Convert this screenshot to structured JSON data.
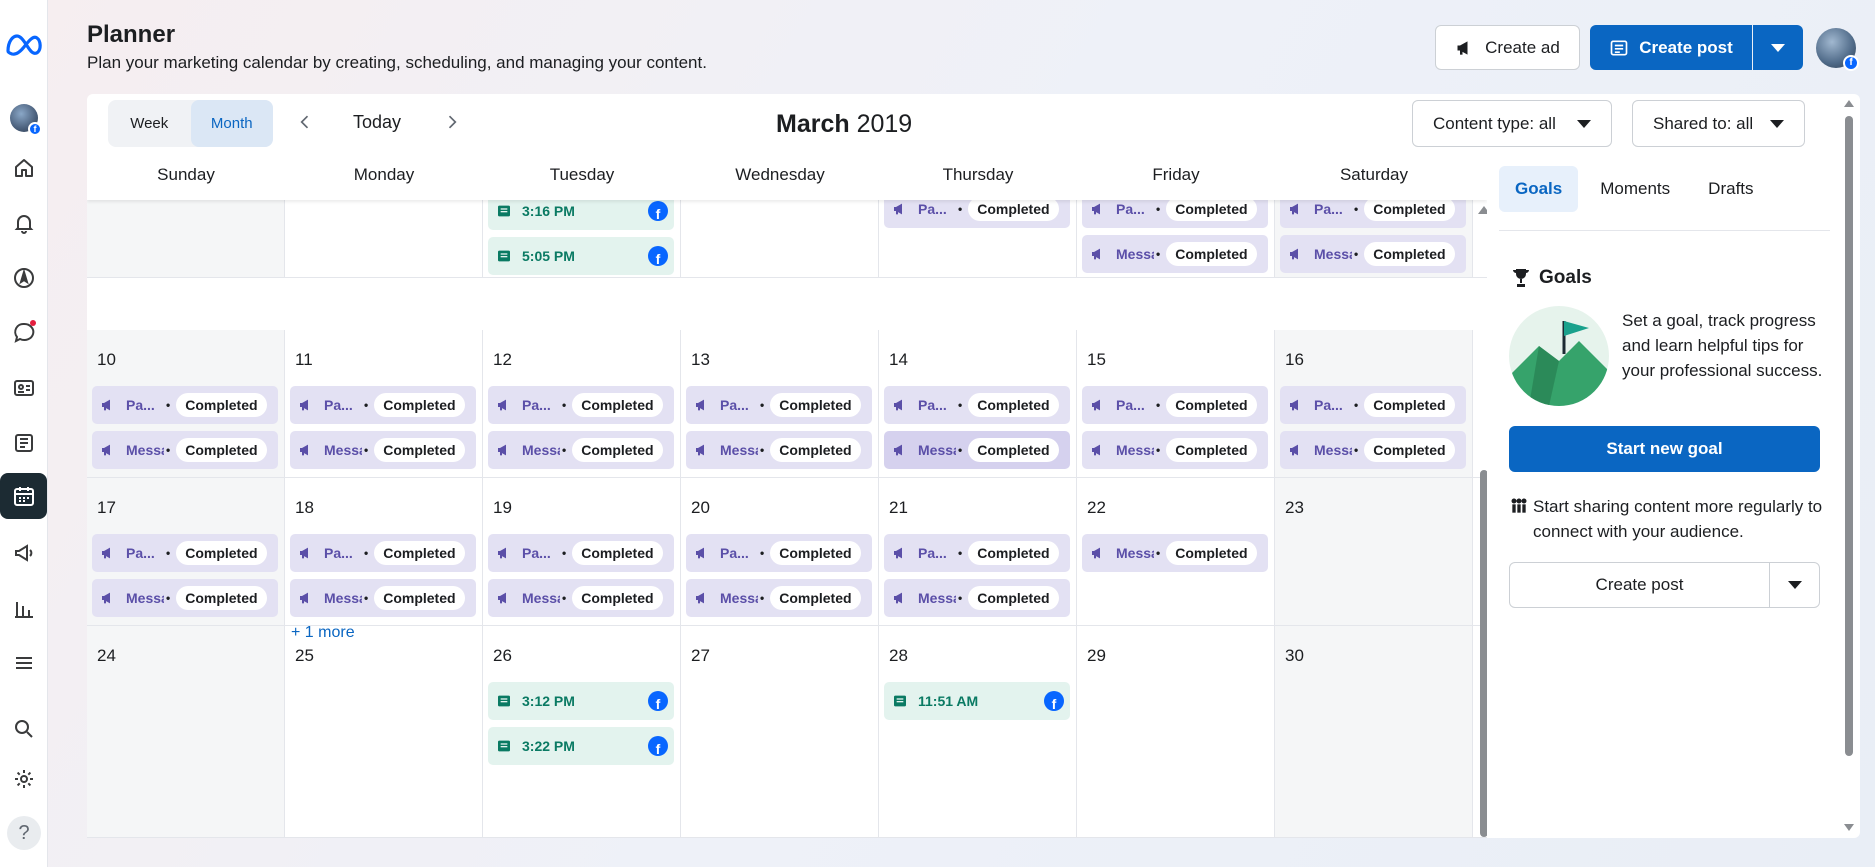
{
  "header": {
    "title": "Planner",
    "subtitle": "Plan your marketing calendar by creating, scheduling, and managing your content.",
    "create_ad": "Create ad",
    "create_post": "Create post"
  },
  "toolbar": {
    "week": "Week",
    "month": "Month",
    "today": "Today",
    "month_name": "March",
    "year": "2019",
    "content_type": "Content type: all",
    "shared_to": "Shared to: all"
  },
  "calendar": {
    "days_of_week": [
      "Sunday",
      "Monday",
      "Tuesday",
      "Wednesday",
      "Thursday",
      "Friday",
      "Saturday"
    ],
    "weeks": [
      {
        "days": [
          {
            "date": "",
            "events": []
          },
          {
            "date": "",
            "events": []
          },
          {
            "date": "",
            "events": [
              {
                "kind": "post",
                "time": "3:16 PM"
              },
              {
                "kind": "post",
                "time": "5:05 PM"
              }
            ]
          },
          {
            "date": "",
            "events": []
          },
          {
            "date": "",
            "events": [
              {
                "kind": "ad",
                "name": "Pa...",
                "status": "Completed"
              }
            ]
          },
          {
            "date": "",
            "events": [
              {
                "kind": "ad",
                "name": "Pa...",
                "status": "Completed"
              },
              {
                "kind": "ad",
                "name": "Messa",
                "status": "Completed"
              }
            ]
          },
          {
            "date": "",
            "events": [
              {
                "kind": "ad",
                "name": "Pa...",
                "status": "Completed"
              },
              {
                "kind": "ad",
                "name": "Messa",
                "status": "Completed"
              }
            ]
          }
        ]
      },
      {
        "days": [
          {
            "date": "10",
            "events": [
              {
                "kind": "ad",
                "name": "Pa...",
                "status": "Completed"
              },
              {
                "kind": "ad",
                "name": "Messa",
                "status": "Completed"
              }
            ]
          },
          {
            "date": "11",
            "events": [
              {
                "kind": "ad",
                "name": "Pa...",
                "status": "Completed"
              },
              {
                "kind": "ad",
                "name": "Messa",
                "status": "Completed"
              }
            ]
          },
          {
            "date": "12",
            "events": [
              {
                "kind": "ad",
                "name": "Pa...",
                "status": "Completed"
              },
              {
                "kind": "ad",
                "name": "Messa",
                "status": "Completed"
              }
            ]
          },
          {
            "date": "13",
            "events": [
              {
                "kind": "ad",
                "name": "Pa...",
                "status": "Completed"
              },
              {
                "kind": "ad",
                "name": "Messa",
                "status": "Completed"
              }
            ]
          },
          {
            "date": "14",
            "events": [
              {
                "kind": "ad",
                "name": "Pa...",
                "status": "Completed"
              },
              {
                "kind": "ad",
                "name": "Messa",
                "status": "Completed",
                "highlight": true
              }
            ]
          },
          {
            "date": "15",
            "events": [
              {
                "kind": "ad",
                "name": "Pa...",
                "status": "Completed"
              },
              {
                "kind": "ad",
                "name": "Messa",
                "status": "Completed"
              }
            ]
          },
          {
            "date": "16",
            "events": [
              {
                "kind": "ad",
                "name": "Pa...",
                "status": "Completed"
              },
              {
                "kind": "ad",
                "name": "Messa",
                "status": "Completed"
              }
            ]
          }
        ]
      },
      {
        "days": [
          {
            "date": "17",
            "events": [
              {
                "kind": "ad",
                "name": "Pa...",
                "status": "Completed"
              },
              {
                "kind": "ad",
                "name": "Messa",
                "status": "Completed"
              }
            ]
          },
          {
            "date": "18",
            "events": [
              {
                "kind": "ad",
                "name": "Pa...",
                "status": "Completed"
              },
              {
                "kind": "ad",
                "name": "Messa",
                "status": "Completed"
              }
            ],
            "more": "+ 1 more"
          },
          {
            "date": "19",
            "events": [
              {
                "kind": "ad",
                "name": "Pa...",
                "status": "Completed"
              },
              {
                "kind": "ad",
                "name": "Messa",
                "status": "Completed"
              }
            ]
          },
          {
            "date": "20",
            "events": [
              {
                "kind": "ad",
                "name": "Pa...",
                "status": "Completed"
              },
              {
                "kind": "ad",
                "name": "Messa",
                "status": "Completed"
              }
            ]
          },
          {
            "date": "21",
            "events": [
              {
                "kind": "ad",
                "name": "Pa...",
                "status": "Completed"
              },
              {
                "kind": "ad",
                "name": "Messa",
                "status": "Completed"
              }
            ]
          },
          {
            "date": "22",
            "events": [
              {
                "kind": "ad",
                "name": "Messa",
                "status": "Completed"
              }
            ]
          },
          {
            "date": "23",
            "events": []
          }
        ]
      },
      {
        "days": [
          {
            "date": "24",
            "events": []
          },
          {
            "date": "25",
            "events": []
          },
          {
            "date": "26",
            "events": [
              {
                "kind": "post",
                "time": "3:12 PM"
              },
              {
                "kind": "post",
                "time": "3:22 PM"
              }
            ]
          },
          {
            "date": "27",
            "events": []
          },
          {
            "date": "28",
            "events": [
              {
                "kind": "post",
                "time": "11:51 AM"
              }
            ]
          },
          {
            "date": "29",
            "events": []
          },
          {
            "date": "30",
            "events": []
          }
        ]
      }
    ]
  },
  "side": {
    "tabs": [
      "Goals",
      "Moments",
      "Drafts"
    ],
    "goals_heading": "Goals",
    "goals_desc": "Set a goal, track progress and learn helpful tips for your professional success.",
    "start_goal": "Start new goal",
    "share_text": "Start sharing content more regularly to connect with your audience.",
    "create_post": "Create post"
  },
  "colors": {
    "primary": "#0a66c2",
    "ad_bg": "#e3e1f3",
    "ad_text": "#5b4fa8",
    "post_bg": "#e3f3ee",
    "post_text": "#0a7a63",
    "facebook": "#0866ff"
  },
  "icons": {
    "rail": [
      "meta-logo",
      "profile-avatar",
      "home-icon",
      "bell-icon",
      "compass-icon",
      "chat-icon",
      "id-card-icon",
      "news-icon",
      "calendar-icon",
      "megaphone-icon",
      "bar-chart-icon",
      "menu-icon",
      "search-icon",
      "gear-icon",
      "help-icon"
    ]
  }
}
